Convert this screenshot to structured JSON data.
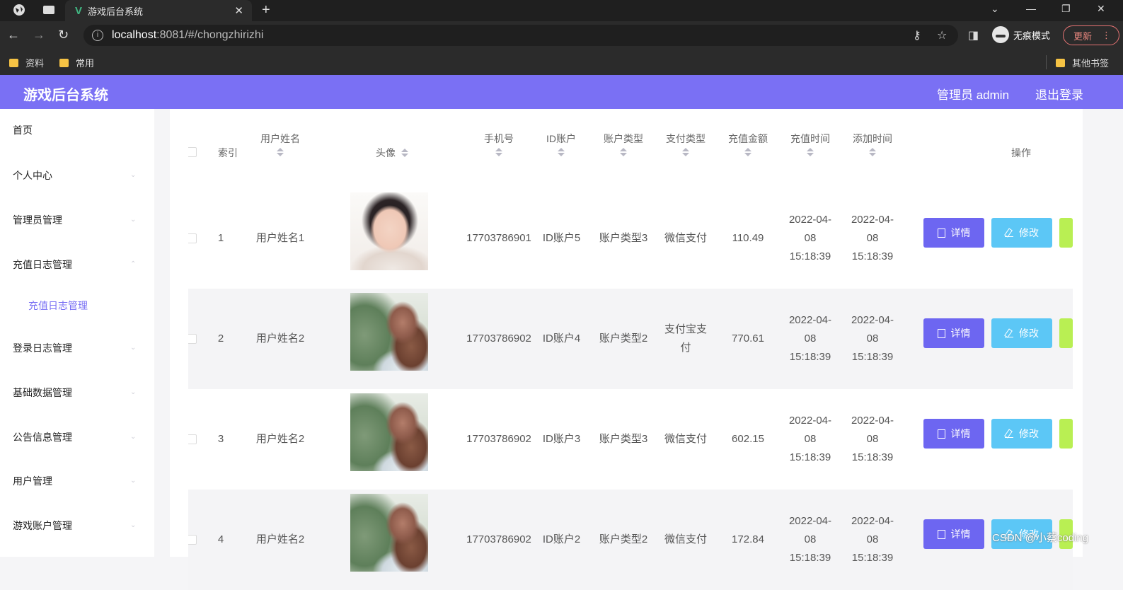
{
  "browser": {
    "tab_title": "游戏后台系统",
    "url_host": "localhost",
    "url_rest": ":8081/#/chongzhirizhi",
    "incognito_label": "无痕模式",
    "update_label": "更新",
    "bookmarks": [
      "资料",
      "常用"
    ],
    "other_bookmarks": "其他书签"
  },
  "app": {
    "title": "游戏后台系统",
    "admin_label": "管理员 admin",
    "logout_label": "退出登录",
    "accent_color": "#7a70f4"
  },
  "sidebar": {
    "items": [
      {
        "label": "首页"
      },
      {
        "label": "个人中心"
      },
      {
        "label": "管理员管理"
      },
      {
        "label": "充值日志管理"
      },
      {
        "label": "充值日志管理",
        "sub": true
      },
      {
        "label": "登录日志管理"
      },
      {
        "label": "基础数据管理"
      },
      {
        "label": "公告信息管理"
      },
      {
        "label": "用户管理"
      },
      {
        "label": "游戏账户管理"
      }
    ]
  },
  "table": {
    "headers": [
      "索引",
      "用户姓名",
      "头像",
      "手机号",
      "ID账户",
      "账户类型",
      "支付类型",
      "充值金额",
      "充值时间",
      "添加时间",
      "操作"
    ],
    "rows": [
      {
        "index": "1",
        "name": "用户姓名1",
        "phone": "17703786901",
        "account": "ID账户5",
        "account_type": "账户类型3",
        "pay_type": "微信支付",
        "amount": "110.49",
        "charge_time": "2022-04-08 15:18:39",
        "add_time": "2022-04-08 15:18:39"
      },
      {
        "index": "2",
        "name": "用户姓名2",
        "phone": "17703786902",
        "account": "ID账户4",
        "account_type": "账户类型2",
        "pay_type": "支付宝支付",
        "amount": "770.61",
        "charge_time": "2022-04-08 15:18:39",
        "add_time": "2022-04-08 15:18:39"
      },
      {
        "index": "3",
        "name": "用户姓名2",
        "phone": "17703786902",
        "account": "ID账户3",
        "account_type": "账户类型3",
        "pay_type": "微信支付",
        "amount": "602.15",
        "charge_time": "2022-04-08 15:18:39",
        "add_time": "2022-04-08 15:18:39"
      },
      {
        "index": "4",
        "name": "用户姓名2",
        "phone": "17703786902",
        "account": "ID账户2",
        "account_type": "账户类型2",
        "pay_type": "微信支付",
        "amount": "172.84",
        "charge_time": "2022-04-08 15:18:39",
        "add_time": "2022-04-08 15:18:39"
      }
    ],
    "actions": {
      "detail": "详情",
      "edit": "修改"
    }
  },
  "watermark": "CSDN @小蔡coding"
}
